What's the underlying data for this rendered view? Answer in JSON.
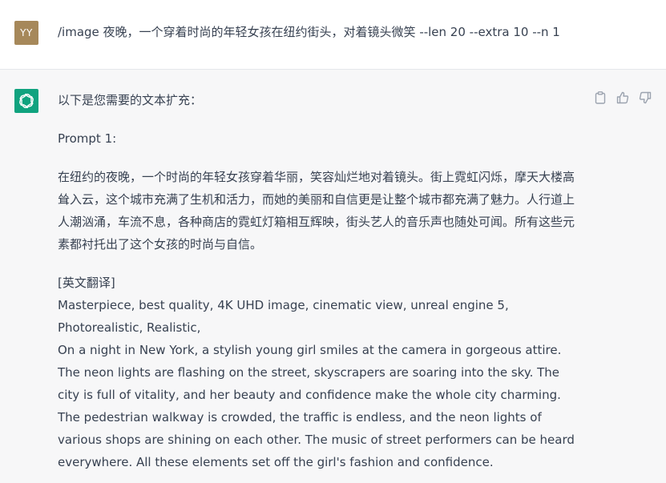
{
  "user": {
    "avatar_initials": "YY",
    "message": "/image 夜晚，一个穿着时尚的年轻女孩在纽约街头，对着镜头微笑 --len 20 --extra 10 --n 1"
  },
  "assistant": {
    "intro": "以下是您需要的文本扩充：",
    "prompt_label": "Prompt 1:",
    "chinese_paragraph": "在纽约的夜晚，一个时尚的年轻女孩穿着华丽，笑容灿烂地对着镜头。街上霓虹闪烁，摩天大楼高耸入云，这个城市充满了生机和活力，而她的美丽和自信更是让整个城市都充满了魅力。人行道上人潮汹涌，车流不息，各种商店的霓虹灯箱相互辉映，街头艺人的音乐声也随处可闻。所有这些元素都衬托出了这个女孩的时尚与自信。",
    "translation_header": "[英文翻译]",
    "english_tags": "Masterpiece, best quality, 4K UHD image, cinematic view, unreal engine 5, Photorealistic, Realistic,",
    "english_paragraph": "On a night in New York, a stylish young girl smiles at the camera in gorgeous attire. The neon lights are flashing on the street, skyscrapers are soaring into the sky. The city is full of vitality, and her beauty and confidence make the whole city charming. The pedestrian walkway is crowded, the traffic is endless, and the neon lights of various shops are shining on each other. The music of street performers can be heard everywhere. All these elements set off the girl's fashion and confidence."
  },
  "actions": [
    "copy-icon",
    "thumbs-up-icon",
    "thumbs-down-icon"
  ],
  "colors": {
    "user_avatar": "#a6885a",
    "bot_avatar": "#10a37f",
    "assistant_bg": "#f7f7f8",
    "text": "#374151"
  }
}
